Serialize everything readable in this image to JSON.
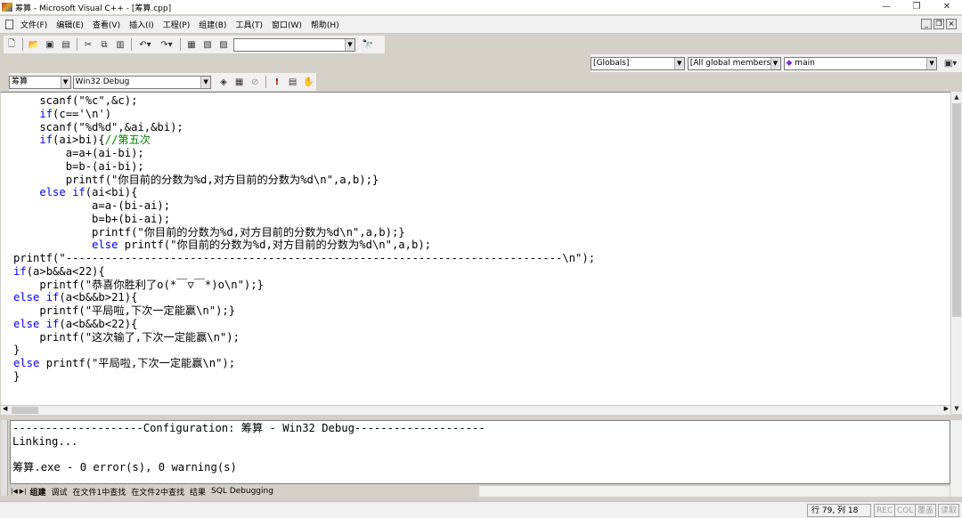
{
  "window": {
    "title": "筹算 - Microsoft Visual C++ - [筹算.cpp]",
    "controls": [
      "—",
      "❐",
      "✕"
    ]
  },
  "menu": {
    "items": [
      "文件(F)",
      "编辑(E)",
      "查看(V)",
      "插入(I)",
      "工程(P)",
      "组建(B)",
      "工具(T)",
      "窗口(W)",
      "帮助(H)"
    ],
    "mdi_controls": [
      "_",
      "❐",
      "×"
    ]
  },
  "toolbar": {
    "find_combo_value": ""
  },
  "wizardbar": {
    "class": "[Globals]",
    "members": "[All global members",
    "function": "main"
  },
  "build_toolbar": {
    "project": "筹算",
    "configuration": "Win32 Debug"
  },
  "output": {
    "lines": [
      "--------------------Configuration: 筹算 - Win32 Debug--------------------",
      "Linking...",
      "",
      "筹算.exe - 0 error(s), 0 warning(s)"
    ],
    "tabs": [
      "组建",
      "调试",
      "在文件1中查找",
      "在文件2中查找",
      "结果",
      "SQL Debugging"
    ]
  },
  "status": {
    "position": "行 79, 列 18",
    "indicators": [
      "REC",
      "COL",
      "覆盖",
      "读取"
    ]
  }
}
